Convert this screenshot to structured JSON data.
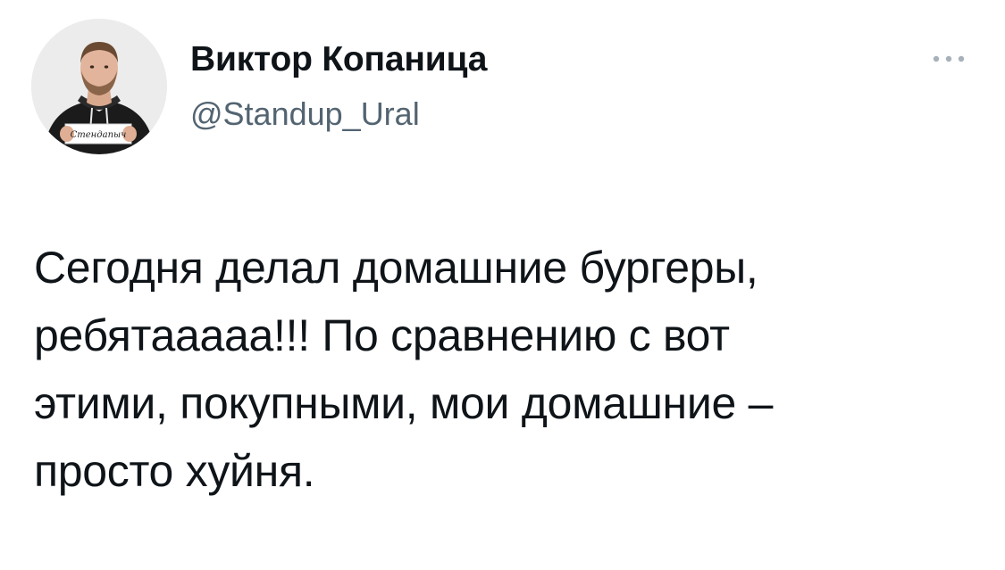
{
  "tweet": {
    "author": {
      "display_name": "Виктор Копаница",
      "handle": "@Standup_Ural",
      "avatar_icon": "profile-photo-avatar",
      "avatar_badge_text": "Стендапыч"
    },
    "more_icon": "more-dots-icon",
    "text": "Сегодня делал домашние бургеры,\nребятааааа!!! По сравнению с вот\nэтими, покупными, мои домашние –\nпросто хуйня."
  },
  "colors": {
    "text_primary": "#0f1419",
    "text_secondary": "#536471",
    "background": "#ffffff"
  }
}
